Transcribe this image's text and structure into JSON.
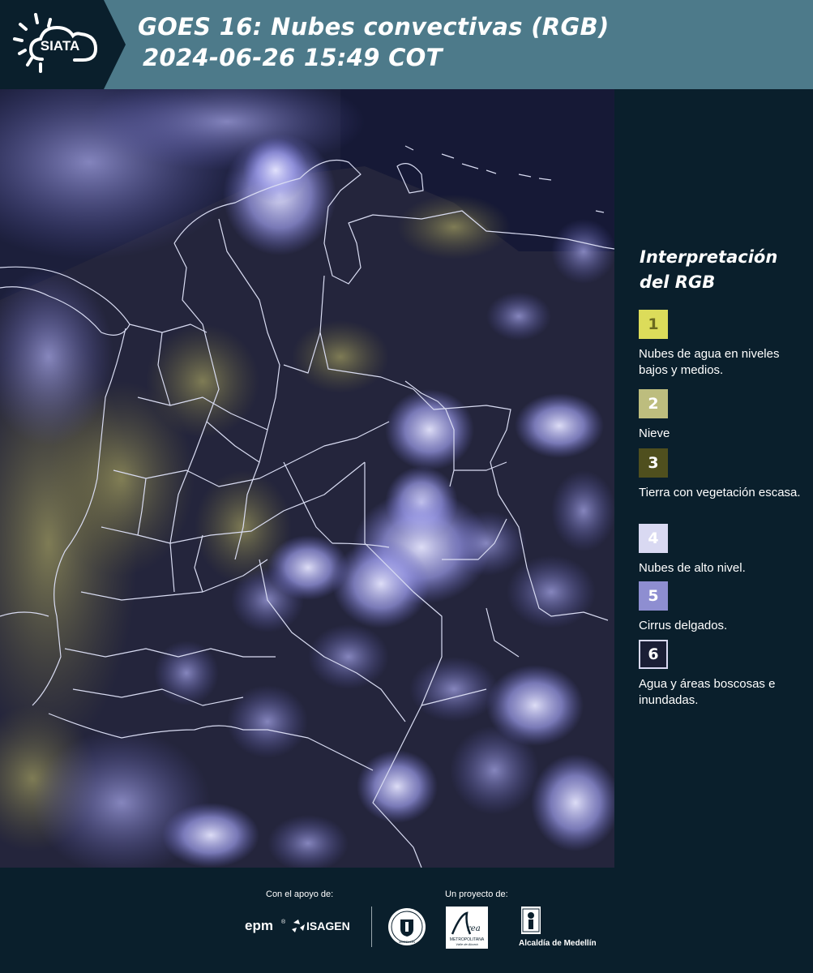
{
  "header": {
    "logo_text": "SIATA",
    "title_line1": "GOES 16: Nubes convectivas (RGB)",
    "title_line2": "2024-06-26 15:49 COT"
  },
  "legend": {
    "title_line1": "Interpretación",
    "title_line2": "del RGB",
    "items": [
      {
        "number": "1",
        "text": "Nubes de agua en niveles bajos y medios.",
        "color": "#dcdc5a",
        "num_color": "#6b6a1f"
      },
      {
        "number": "2",
        "text": "Nieve",
        "color": "#bdbd7e",
        "num_color": "#ffffff"
      },
      {
        "number": "3",
        "text": "Tierra con vegetación escasa.",
        "color": "#4f4f1e",
        "num_color": "#ffffff"
      },
      {
        "number": "4",
        "text": "Nubes de alto nivel.",
        "color": "#d9d9f2",
        "num_color": "#ffffff"
      },
      {
        "number": "5",
        "text": "Cirrus delgados.",
        "color": "#8e8ed1",
        "num_color": "#ffffff"
      },
      {
        "number": "6",
        "text": "Agua y áreas boscosas e inundadas.",
        "color": "#1a1e35",
        "num_color": "#ffffff"
      }
    ]
  },
  "footer": {
    "support_label": "Con el apoyo de:",
    "project_label": "Un proyecto de:",
    "sponsors": [
      "epm",
      "ISAGEN"
    ],
    "partners": [
      "Área Metropolitana Valle de Aburrá",
      "Alcaldía de Medellín"
    ],
    "metro_text_1": "METROPOLITANA",
    "metro_text_2": "Valle de Aburrá",
    "alcaldia_text": "Alcaldía de Medellín",
    "seal_text": "MEDELLÍN"
  },
  "colors": {
    "header_bg": "#4d7a8a",
    "panel_bg": "#0a1f2c",
    "map_bg": "#1a1d3a",
    "cloud": "#a9a9f0",
    "low_cloud": "#c8c46a",
    "border_line": "#d9dcf2"
  },
  "icons": [
    "sun-cloud-logo-icon",
    "epm-logo-icon",
    "isagen-logo-icon",
    "medellin-seal-icon",
    "area-metropolitana-logo-icon",
    "alcaldia-building-icon"
  ]
}
